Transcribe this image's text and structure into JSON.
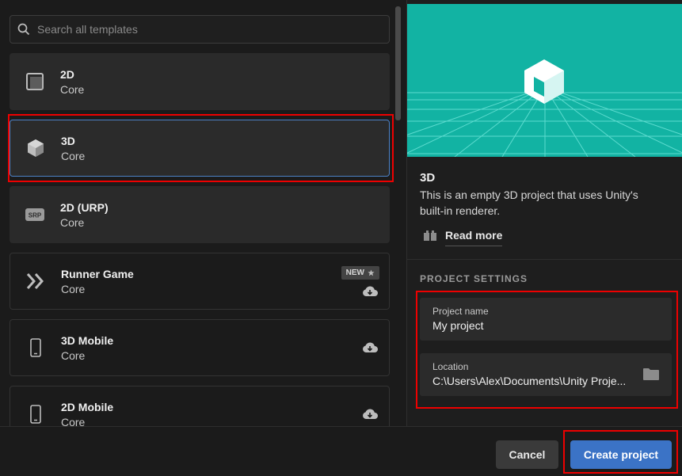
{
  "search": {
    "placeholder": "Search all templates"
  },
  "templates": [
    {
      "title": "2D",
      "subtitle": "Core",
      "icon": "square-icon"
    },
    {
      "title": "3D",
      "subtitle": "Core",
      "icon": "cube-icon"
    },
    {
      "title": "2D (URP)",
      "subtitle": "Core",
      "icon": "srp-icon",
      "icon_text": "SRP"
    },
    {
      "title": "Runner Game",
      "subtitle": "Core",
      "icon": "double-chevron-icon",
      "badge": "NEW",
      "downloadable": true
    },
    {
      "title": "3D Mobile",
      "subtitle": "Core",
      "icon": "phone-icon",
      "downloadable": true
    },
    {
      "title": "2D Mobile",
      "subtitle": "Core",
      "icon": "phone-icon",
      "downloadable": true
    }
  ],
  "selected_template": "3D",
  "details": {
    "title": "3D",
    "description": "This is an empty 3D project that uses Unity's built-in renderer.",
    "read_more": "Read more"
  },
  "project_settings": {
    "heading": "PROJECT SETTINGS",
    "name_label": "Project name",
    "name_value": "My project",
    "location_label": "Location",
    "location_value": "C:\\Users\\Alex\\Documents\\Unity Proje..."
  },
  "footer": {
    "cancel_label": "Cancel",
    "create_label": "Create project"
  },
  "colors": {
    "accent": "#3b73c6",
    "preview_bg": "#12b3a3",
    "highlight": "#e00000"
  }
}
